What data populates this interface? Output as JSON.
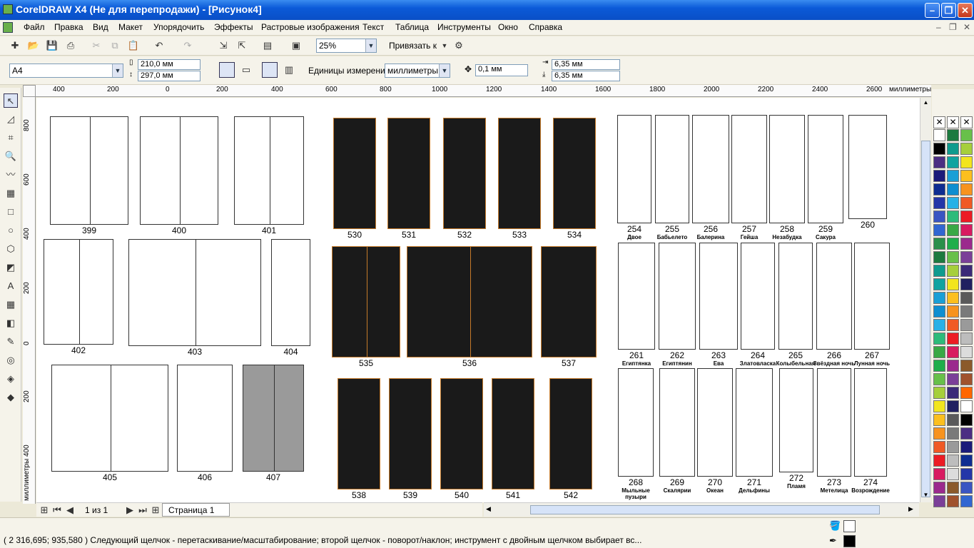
{
  "window": {
    "title": "CorelDRAW X4 (Не для перепродажи) - [Рисунок4]"
  },
  "menu": [
    "Файл",
    "Правка",
    "Вид",
    "Макет",
    "Упорядочить",
    "Эффекты",
    "Растровые изображения",
    "Текст",
    "Таблица",
    "Инструменты",
    "Окно",
    "Справка"
  ],
  "toolbar": {
    "zoom": "25%",
    "snap_label": "Привязать к"
  },
  "props": {
    "page_size": "A4",
    "width": "210,0 мм",
    "height": "297,0 мм",
    "units_label": "Единицы измерения:",
    "units": "миллиметры",
    "nudge": "0,1 мм",
    "dup_x": "6,35 мм",
    "dup_y": "6,35 мм"
  },
  "ruler": {
    "unit": "миллиметры",
    "top": [
      "400",
      "200",
      "0",
      "200",
      "400",
      "600",
      "800",
      "1000",
      "1200",
      "1400",
      "1600",
      "1800",
      "2000",
      "2200",
      "2400",
      "2600"
    ],
    "left": [
      "800",
      "600",
      "400",
      "200",
      "0",
      "200",
      "400"
    ]
  },
  "panels": {
    "g1": [
      {
        "n": "399"
      },
      {
        "n": "400"
      },
      {
        "n": "401"
      }
    ],
    "g2": [
      {
        "n": "402"
      },
      {
        "n": "403"
      },
      {
        "n": "404"
      }
    ],
    "g3": [
      {
        "n": "405"
      },
      {
        "n": "406"
      },
      {
        "n": "407"
      }
    ],
    "g4": [
      {
        "n": "530"
      },
      {
        "n": "531"
      },
      {
        "n": "532"
      },
      {
        "n": "533"
      },
      {
        "n": "534"
      }
    ],
    "g5": [
      {
        "n": "535"
      },
      {
        "n": "536"
      },
      {
        "n": "537"
      }
    ],
    "g6": [
      {
        "n": "538"
      },
      {
        "n": "539"
      },
      {
        "n": "540"
      },
      {
        "n": "541"
      },
      {
        "n": "542"
      }
    ],
    "g7": [
      {
        "n": "254",
        "c": "Двое"
      },
      {
        "n": "255",
        "c": "Бабьелето"
      },
      {
        "n": "256",
        "c": "Балерина"
      },
      {
        "n": "257",
        "c": "Гейша"
      },
      {
        "n": "258",
        "c": "Незабудка"
      },
      {
        "n": "259",
        "c": "Сакура"
      },
      {
        "n": "260",
        "c": ""
      }
    ],
    "g8": [
      {
        "n": "261",
        "c": "Египтянка"
      },
      {
        "n": "262",
        "c": "Египтянин"
      },
      {
        "n": "263",
        "c": "Ева"
      },
      {
        "n": "264",
        "c": "Златовласка"
      },
      {
        "n": "265",
        "c": "Колыбельная"
      },
      {
        "n": "266",
        "c": "Звёздная ночь"
      },
      {
        "n": "267",
        "c": "Лунная ночь"
      }
    ],
    "g9": [
      {
        "n": "268",
        "c": "Мыльные пузыри"
      },
      {
        "n": "269",
        "c": "Скалярии"
      },
      {
        "n": "270",
        "c": "Океан"
      },
      {
        "n": "271",
        "c": "Дельфины"
      },
      {
        "n": "272",
        "c": "Пламя"
      },
      {
        "n": "273",
        "c": "Метелица"
      },
      {
        "n": "274",
        "c": "Возрождение"
      }
    ]
  },
  "pages": {
    "counter": "1 из 1",
    "tab": "Страница 1"
  },
  "status": {
    "text": "( 2 316,695; 935,580 )  Следующий щелчок - перетаскивание/масштабирование; второй щелчок - поворот/наклон; инструмент с двойным щелчком выбирает вс..."
  },
  "palette_colors": [
    "#ffffff",
    "#000000",
    "#4b2e83",
    "#1b1b7a",
    "#0e2d91",
    "#2436a8",
    "#3a55c2",
    "#3166d1",
    "#2a8f4a",
    "#1d7a3f",
    "#0f9b8e",
    "#10a3a0",
    "#1a9fd6",
    "#0e8ed0",
    "#27b1e6",
    "#2dbb7a",
    "#39a845",
    "#1fae4b",
    "#68c04a",
    "#a6cf3b",
    "#f2e51d",
    "#fcbf1e",
    "#f7931e",
    "#f05a24",
    "#ec1c24",
    "#d81b60",
    "#9b2a8d",
    "#7b3f98",
    "#3b2a78",
    "#202060",
    "#5a5a5a",
    "#7a7a7a",
    "#9a9a9a",
    "#bdbdbd",
    "#dcdcdc",
    "#8b5a2b",
    "#a0522d",
    "#ff6600"
  ]
}
